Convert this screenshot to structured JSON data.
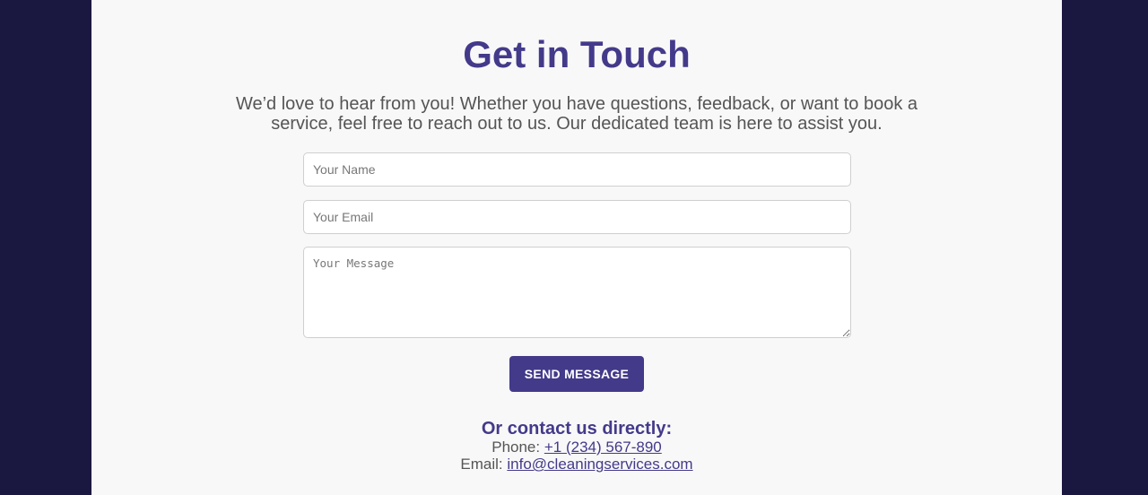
{
  "contact": {
    "title": "Get in Touch",
    "intro": "We’d love to hear from you! Whether you have questions, feedback, or want to book a service, feel free to reach out to us. Our dedicated team is here to assist you.",
    "form": {
      "name_placeholder": "Your Name",
      "email_placeholder": "Your Email",
      "message_placeholder": "Your Message",
      "send_label": "Send Message"
    },
    "direct": {
      "heading": "Or contact us directly:",
      "phone_label": "Phone:",
      "phone_value": "+1 (234) 567-890",
      "email_label": "Email:",
      "email_value": "info@cleaningservices.com"
    }
  },
  "colors": {
    "page_background": "#1a1840",
    "panel_background": "#f8f8f8",
    "accent": "#433a8a",
    "body_text": "#555555"
  }
}
